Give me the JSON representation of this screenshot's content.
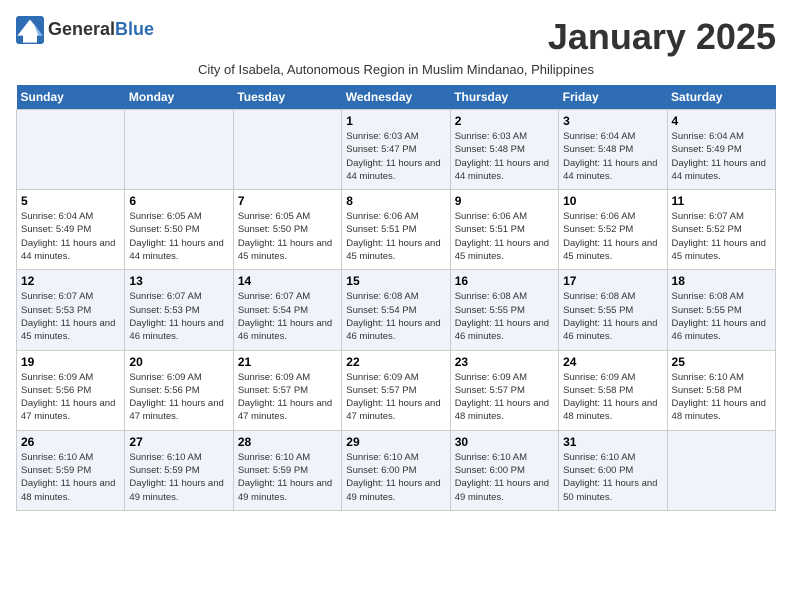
{
  "header": {
    "logo_general": "General",
    "logo_blue": "Blue",
    "month_title": "January 2025",
    "subtitle": "City of Isabela, Autonomous Region in Muslim Mindanao, Philippines"
  },
  "weekdays": [
    "Sunday",
    "Monday",
    "Tuesday",
    "Wednesday",
    "Thursday",
    "Friday",
    "Saturday"
  ],
  "weeks": [
    [
      {
        "day": "",
        "sunrise": "",
        "sunset": "",
        "daylight": ""
      },
      {
        "day": "",
        "sunrise": "",
        "sunset": "",
        "daylight": ""
      },
      {
        "day": "",
        "sunrise": "",
        "sunset": "",
        "daylight": ""
      },
      {
        "day": "1",
        "sunrise": "Sunrise: 6:03 AM",
        "sunset": "Sunset: 5:47 PM",
        "daylight": "Daylight: 11 hours and 44 minutes."
      },
      {
        "day": "2",
        "sunrise": "Sunrise: 6:03 AM",
        "sunset": "Sunset: 5:48 PM",
        "daylight": "Daylight: 11 hours and 44 minutes."
      },
      {
        "day": "3",
        "sunrise": "Sunrise: 6:04 AM",
        "sunset": "Sunset: 5:48 PM",
        "daylight": "Daylight: 11 hours and 44 minutes."
      },
      {
        "day": "4",
        "sunrise": "Sunrise: 6:04 AM",
        "sunset": "Sunset: 5:49 PM",
        "daylight": "Daylight: 11 hours and 44 minutes."
      }
    ],
    [
      {
        "day": "5",
        "sunrise": "Sunrise: 6:04 AM",
        "sunset": "Sunset: 5:49 PM",
        "daylight": "Daylight: 11 hours and 44 minutes."
      },
      {
        "day": "6",
        "sunrise": "Sunrise: 6:05 AM",
        "sunset": "Sunset: 5:50 PM",
        "daylight": "Daylight: 11 hours and 44 minutes."
      },
      {
        "day": "7",
        "sunrise": "Sunrise: 6:05 AM",
        "sunset": "Sunset: 5:50 PM",
        "daylight": "Daylight: 11 hours and 45 minutes."
      },
      {
        "day": "8",
        "sunrise": "Sunrise: 6:06 AM",
        "sunset": "Sunset: 5:51 PM",
        "daylight": "Daylight: 11 hours and 45 minutes."
      },
      {
        "day": "9",
        "sunrise": "Sunrise: 6:06 AM",
        "sunset": "Sunset: 5:51 PM",
        "daylight": "Daylight: 11 hours and 45 minutes."
      },
      {
        "day": "10",
        "sunrise": "Sunrise: 6:06 AM",
        "sunset": "Sunset: 5:52 PM",
        "daylight": "Daylight: 11 hours and 45 minutes."
      },
      {
        "day": "11",
        "sunrise": "Sunrise: 6:07 AM",
        "sunset": "Sunset: 5:52 PM",
        "daylight": "Daylight: 11 hours and 45 minutes."
      }
    ],
    [
      {
        "day": "12",
        "sunrise": "Sunrise: 6:07 AM",
        "sunset": "Sunset: 5:53 PM",
        "daylight": "Daylight: 11 hours and 45 minutes."
      },
      {
        "day": "13",
        "sunrise": "Sunrise: 6:07 AM",
        "sunset": "Sunset: 5:53 PM",
        "daylight": "Daylight: 11 hours and 46 minutes."
      },
      {
        "day": "14",
        "sunrise": "Sunrise: 6:07 AM",
        "sunset": "Sunset: 5:54 PM",
        "daylight": "Daylight: 11 hours and 46 minutes."
      },
      {
        "day": "15",
        "sunrise": "Sunrise: 6:08 AM",
        "sunset": "Sunset: 5:54 PM",
        "daylight": "Daylight: 11 hours and 46 minutes."
      },
      {
        "day": "16",
        "sunrise": "Sunrise: 6:08 AM",
        "sunset": "Sunset: 5:55 PM",
        "daylight": "Daylight: 11 hours and 46 minutes."
      },
      {
        "day": "17",
        "sunrise": "Sunrise: 6:08 AM",
        "sunset": "Sunset: 5:55 PM",
        "daylight": "Daylight: 11 hours and 46 minutes."
      },
      {
        "day": "18",
        "sunrise": "Sunrise: 6:08 AM",
        "sunset": "Sunset: 5:55 PM",
        "daylight": "Daylight: 11 hours and 46 minutes."
      }
    ],
    [
      {
        "day": "19",
        "sunrise": "Sunrise: 6:09 AM",
        "sunset": "Sunset: 5:56 PM",
        "daylight": "Daylight: 11 hours and 47 minutes."
      },
      {
        "day": "20",
        "sunrise": "Sunrise: 6:09 AM",
        "sunset": "Sunset: 5:56 PM",
        "daylight": "Daylight: 11 hours and 47 minutes."
      },
      {
        "day": "21",
        "sunrise": "Sunrise: 6:09 AM",
        "sunset": "Sunset: 5:57 PM",
        "daylight": "Daylight: 11 hours and 47 minutes."
      },
      {
        "day": "22",
        "sunrise": "Sunrise: 6:09 AM",
        "sunset": "Sunset: 5:57 PM",
        "daylight": "Daylight: 11 hours and 47 minutes."
      },
      {
        "day": "23",
        "sunrise": "Sunrise: 6:09 AM",
        "sunset": "Sunset: 5:57 PM",
        "daylight": "Daylight: 11 hours and 48 minutes."
      },
      {
        "day": "24",
        "sunrise": "Sunrise: 6:09 AM",
        "sunset": "Sunset: 5:58 PM",
        "daylight": "Daylight: 11 hours and 48 minutes."
      },
      {
        "day": "25",
        "sunrise": "Sunrise: 6:10 AM",
        "sunset": "Sunset: 5:58 PM",
        "daylight": "Daylight: 11 hours and 48 minutes."
      }
    ],
    [
      {
        "day": "26",
        "sunrise": "Sunrise: 6:10 AM",
        "sunset": "Sunset: 5:59 PM",
        "daylight": "Daylight: 11 hours and 48 minutes."
      },
      {
        "day": "27",
        "sunrise": "Sunrise: 6:10 AM",
        "sunset": "Sunset: 5:59 PM",
        "daylight": "Daylight: 11 hours and 49 minutes."
      },
      {
        "day": "28",
        "sunrise": "Sunrise: 6:10 AM",
        "sunset": "Sunset: 5:59 PM",
        "daylight": "Daylight: 11 hours and 49 minutes."
      },
      {
        "day": "29",
        "sunrise": "Sunrise: 6:10 AM",
        "sunset": "Sunset: 6:00 PM",
        "daylight": "Daylight: 11 hours and 49 minutes."
      },
      {
        "day": "30",
        "sunrise": "Sunrise: 6:10 AM",
        "sunset": "Sunset: 6:00 PM",
        "daylight": "Daylight: 11 hours and 49 minutes."
      },
      {
        "day": "31",
        "sunrise": "Sunrise: 6:10 AM",
        "sunset": "Sunset: 6:00 PM",
        "daylight": "Daylight: 11 hours and 50 minutes."
      },
      {
        "day": "",
        "sunrise": "",
        "sunset": "",
        "daylight": ""
      }
    ]
  ]
}
